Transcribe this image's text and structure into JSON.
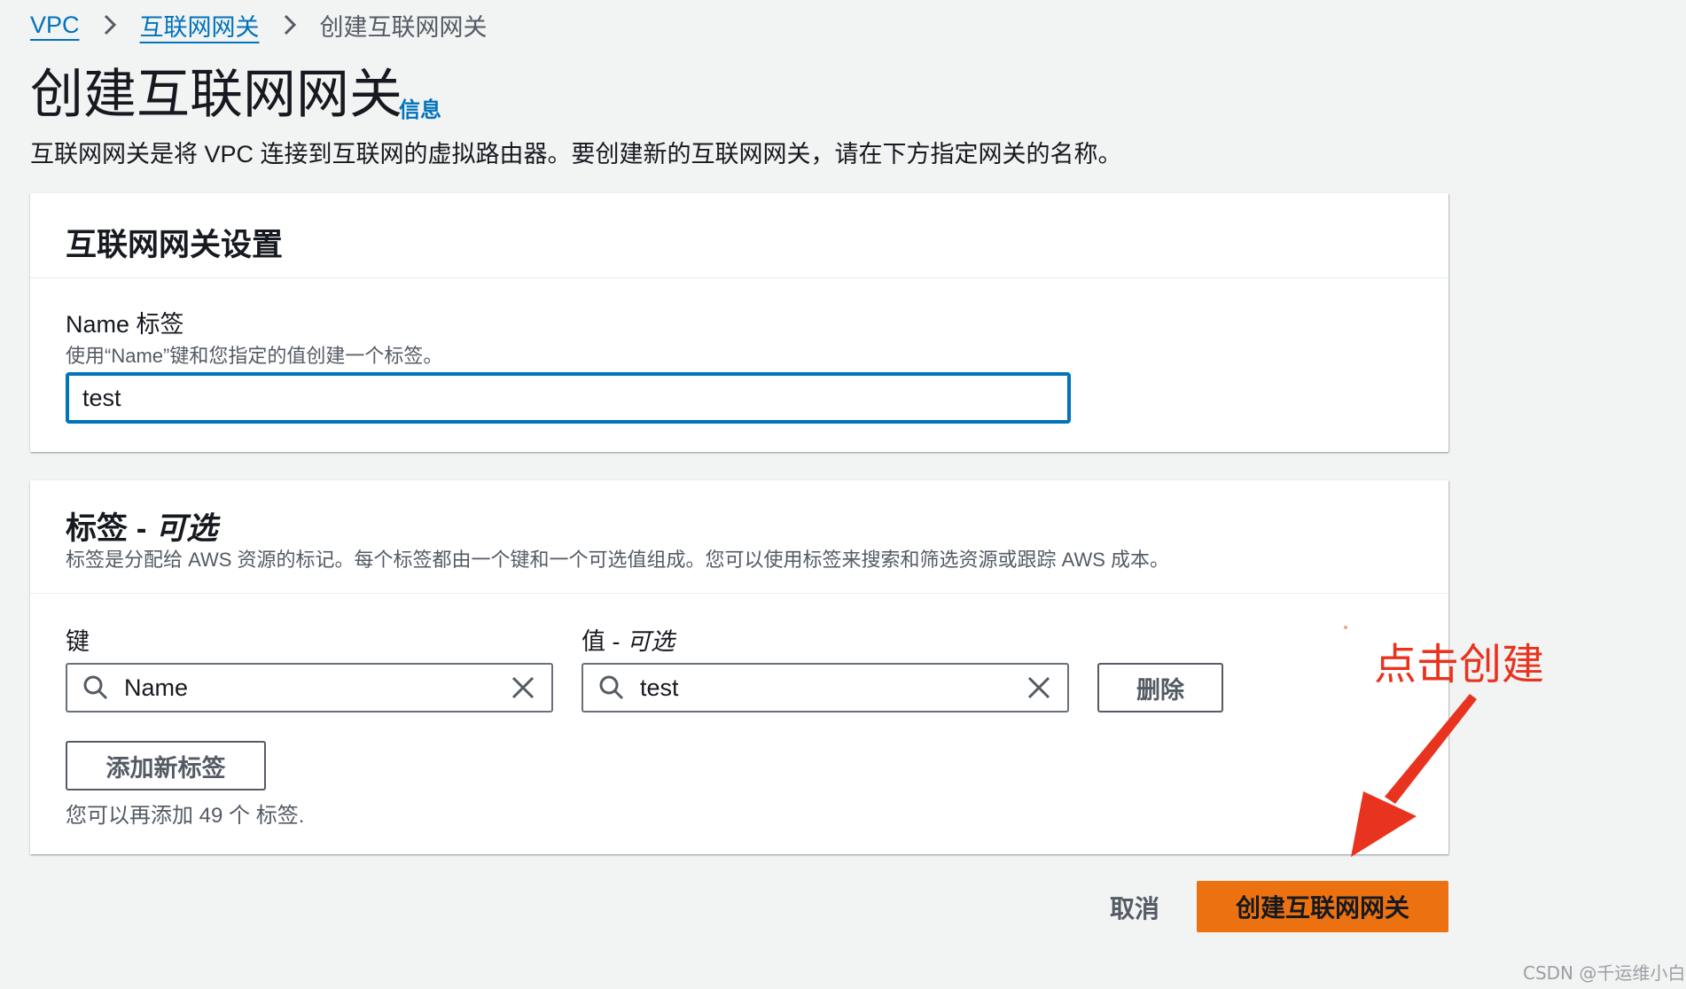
{
  "breadcrumb": {
    "items": [
      {
        "label": "VPC"
      },
      {
        "label": "互联网网关"
      },
      {
        "label": "创建互联网网关"
      }
    ]
  },
  "page": {
    "title": "创建互联网网关",
    "info_link": "信息",
    "description": "互联网网关是将 VPC 连接到互联网的虚拟路由器。要创建新的互联网网关，请在下方指定网关的名称。"
  },
  "settings_panel": {
    "title": "互联网网关设置",
    "name_label": "Name 标签",
    "name_hint": "使用“Name”键和您指定的值创建一个标签。",
    "name_value": "test"
  },
  "tags_panel": {
    "title": "标签 -",
    "title_optional": "可选",
    "description": "标签是分配给 AWS 资源的标记。每个标签都由一个键和一个可选值组成。您可以使用标签来搜索和筛选资源或跟踪 AWS 成本。",
    "key_label": "键",
    "value_label": "值 -",
    "value_optional": "可选",
    "key_value": "Name",
    "value_value": "test",
    "remove_button": "删除",
    "add_button": "添加新标签",
    "remaining": "您可以再添加 49 个 标签."
  },
  "footer": {
    "cancel": "取消",
    "create": "创建互联网网关"
  },
  "annotation": {
    "text": "点击创建",
    "color": "#e8341f"
  },
  "watermark": "CSDN @千运维小白",
  "colors": {
    "primary_button": "#ec7211",
    "link": "#0073bb",
    "focus_border": "#0073bb"
  }
}
